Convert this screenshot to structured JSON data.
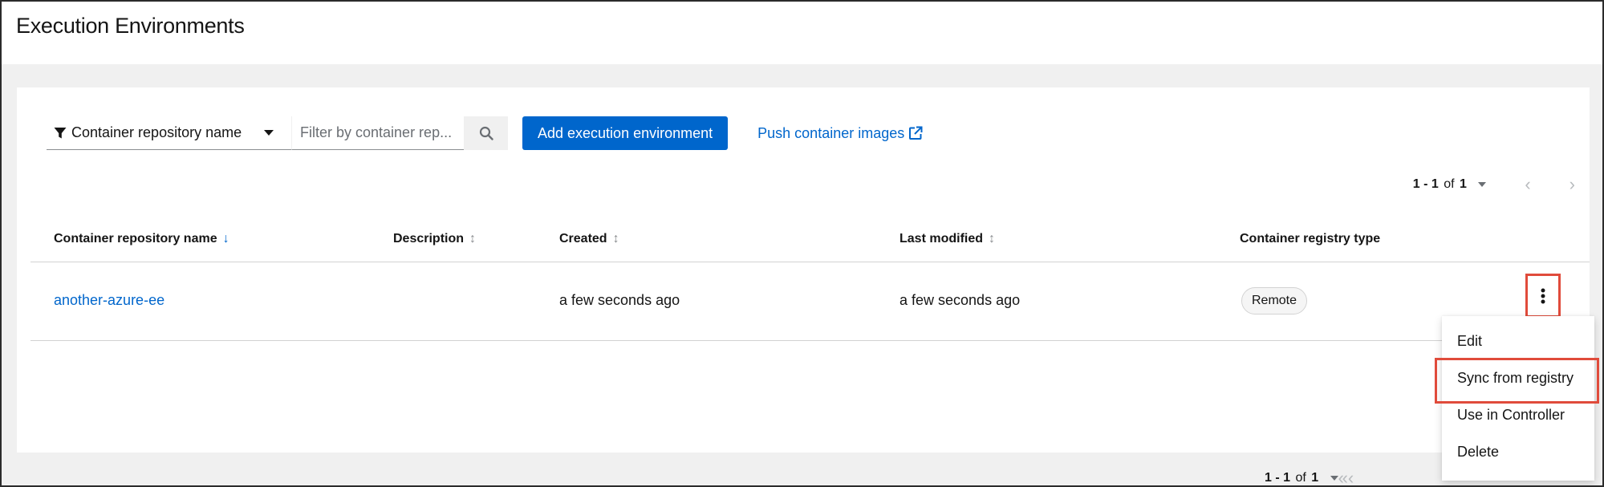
{
  "page": {
    "title": "Execution Environments"
  },
  "toolbar": {
    "filter_attribute": "Container repository name",
    "filter_placeholder": "Filter by container rep...",
    "add_button": "Add execution environment",
    "push_link": "Push container images"
  },
  "pagination_top": {
    "range": "1 - 1",
    "of_label": "of",
    "total": "1"
  },
  "table": {
    "columns": [
      {
        "label": "Container repository name",
        "sort": "descending-active"
      },
      {
        "label": "Description",
        "sort": "sortable"
      },
      {
        "label": "Created",
        "sort": "sortable"
      },
      {
        "label": "Last modified",
        "sort": "sortable"
      },
      {
        "label": "Container registry type",
        "sort": "none"
      }
    ],
    "rows": [
      {
        "name": "another-azure-ee",
        "description": "",
        "created": "a few seconds ago",
        "last_modified": "a few seconds ago",
        "registry_type": "Remote"
      }
    ]
  },
  "pagination_bottom": {
    "range": "1 - 1",
    "of_label": "of",
    "total": "1"
  },
  "row_menu": {
    "items": [
      "Edit",
      "Sync from registry",
      "Use in Controller",
      "Delete"
    ],
    "highlighted_item": "Sync from registry"
  },
  "colors": {
    "primary": "#0066cc",
    "highlight": "#e04b3b",
    "text": "#151515",
    "background": "#f0f0f0"
  }
}
